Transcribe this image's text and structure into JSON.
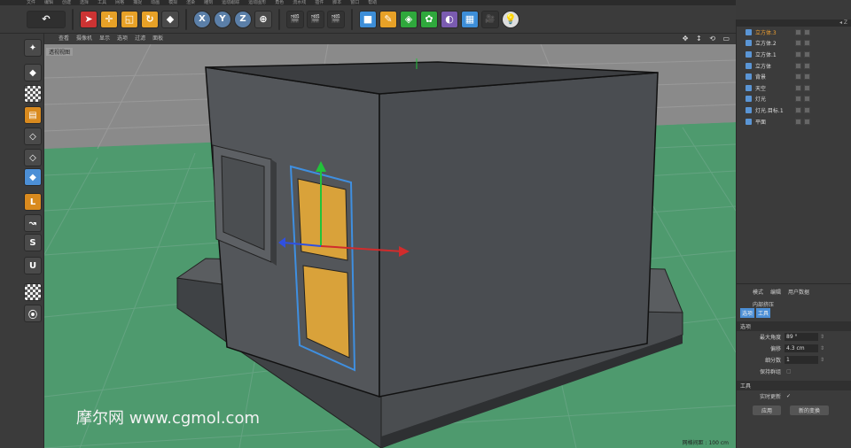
{
  "menubar": [
    "文件",
    "编辑",
    "创建",
    "选择",
    "工具",
    "网格",
    "捕捉",
    "动画",
    "模拟",
    "渲染",
    "雕刻",
    "运动跟踪",
    "运动图形",
    "角色",
    "流水线",
    "插件",
    "脚本",
    "窗口",
    "帮助"
  ],
  "toolbar": {
    "undo_icon": "undo-icon",
    "axis_x": "X",
    "axis_y": "Y",
    "axis_z": "Z"
  },
  "viewport": {
    "menu": [
      "查看",
      "摄像机",
      "显示",
      "选项",
      "过滤",
      "面板"
    ],
    "label": "透视视图",
    "grid_readout": "网格间距 : 100 cm",
    "watermark": "摩尔网 www.cgmol.com",
    "colors": {
      "ground": "#4a9a6e",
      "box": "#56595c",
      "door": "#d9a23a",
      "selection": "#3f8fe0"
    }
  },
  "objects": {
    "header_btn": "◂ Z",
    "rows": [
      {
        "label": "立方体.3",
        "icon": "cube-icon",
        "active": true
      },
      {
        "label": "立方体.2",
        "icon": "cube-icon",
        "active": false
      },
      {
        "label": "立方体.1",
        "icon": "cube-icon",
        "active": false
      },
      {
        "label": "立方体",
        "icon": "cube-icon",
        "active": false
      },
      {
        "label": "背景",
        "icon": "background-icon",
        "active": false
      },
      {
        "label": "天空",
        "icon": "sky-icon",
        "active": false
      },
      {
        "label": "灯光",
        "icon": "light-icon",
        "active": false
      },
      {
        "label": "灯光.目标.1",
        "icon": "light-target-icon",
        "active": false
      },
      {
        "label": "平面",
        "icon": "plane-icon",
        "active": false
      }
    ]
  },
  "attributes": {
    "tabs": [
      "模式",
      "编辑",
      "用户数据"
    ],
    "title": "内部挤压",
    "subtabs": [
      "选项",
      "工具"
    ],
    "section_options": "选项",
    "fields": [
      {
        "label": "最大角度",
        "value": "89 °"
      },
      {
        "label": "偏移",
        "value": "4.3 cm"
      },
      {
        "label": "细分数",
        "value": "1"
      }
    ],
    "keep_group": "保持群组",
    "section_tool": "工具",
    "realtime": "实时更新",
    "realtime_mark": "✓",
    "apply": "应用",
    "new_transform": "新的变换"
  }
}
